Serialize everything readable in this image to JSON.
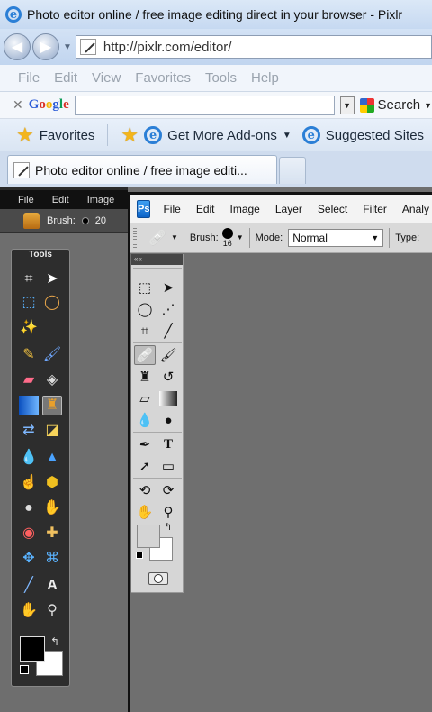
{
  "browser": {
    "window_title": "Photo editor online / free image editing direct in your browser - Pixlr",
    "url": "http://pixlr.com/editor/",
    "menu": [
      "File",
      "Edit",
      "View",
      "Favorites",
      "Tools",
      "Help"
    ],
    "google_label": "Google",
    "search_button": "Search",
    "favorites_label": "Favorites",
    "addons_label": "Get More Add-ons",
    "suggested_label": "Suggested Sites",
    "active_tab_title": "Photo editor online / free image editi..."
  },
  "pixlr": {
    "menu": [
      "File",
      "Edit",
      "Image"
    ],
    "brush_label": "Brush:",
    "brush_size": "20",
    "tools_title": "Tools",
    "icons": [
      "crop-icon",
      "move-icon",
      "marquee-icon",
      "lasso-icon",
      "wand-icon",
      "pencil-icon",
      "brush-icon",
      "eraser-icon",
      "bucket-icon",
      "gradient-icon",
      "stamp-icon",
      "color-replace-icon",
      "drawing-icon",
      "blur-icon",
      "sharpen-icon",
      "smudge-icon",
      "sponge-icon",
      "dodge-icon",
      "burn-icon",
      "redeye-icon",
      "spotheal-icon",
      "bloat-icon",
      "pinch-icon",
      "picker-icon",
      "type-icon",
      "hand-icon",
      "zoom-icon"
    ]
  },
  "photoshop": {
    "logo": "Ps",
    "menu": [
      "File",
      "Edit",
      "Image",
      "Layer",
      "Select",
      "Filter",
      "Analy"
    ],
    "brush_label": "Brush:",
    "brush_size": "16",
    "mode_label": "Mode:",
    "mode_value": "Normal",
    "type_label": "Type:",
    "panel_collapse": "««"
  },
  "colors": {
    "pixlr_fg": "#000000",
    "pixlr_bg": "#ffffff",
    "ps_fg": "#d4d4d4",
    "ps_bg": "#ffffff"
  }
}
